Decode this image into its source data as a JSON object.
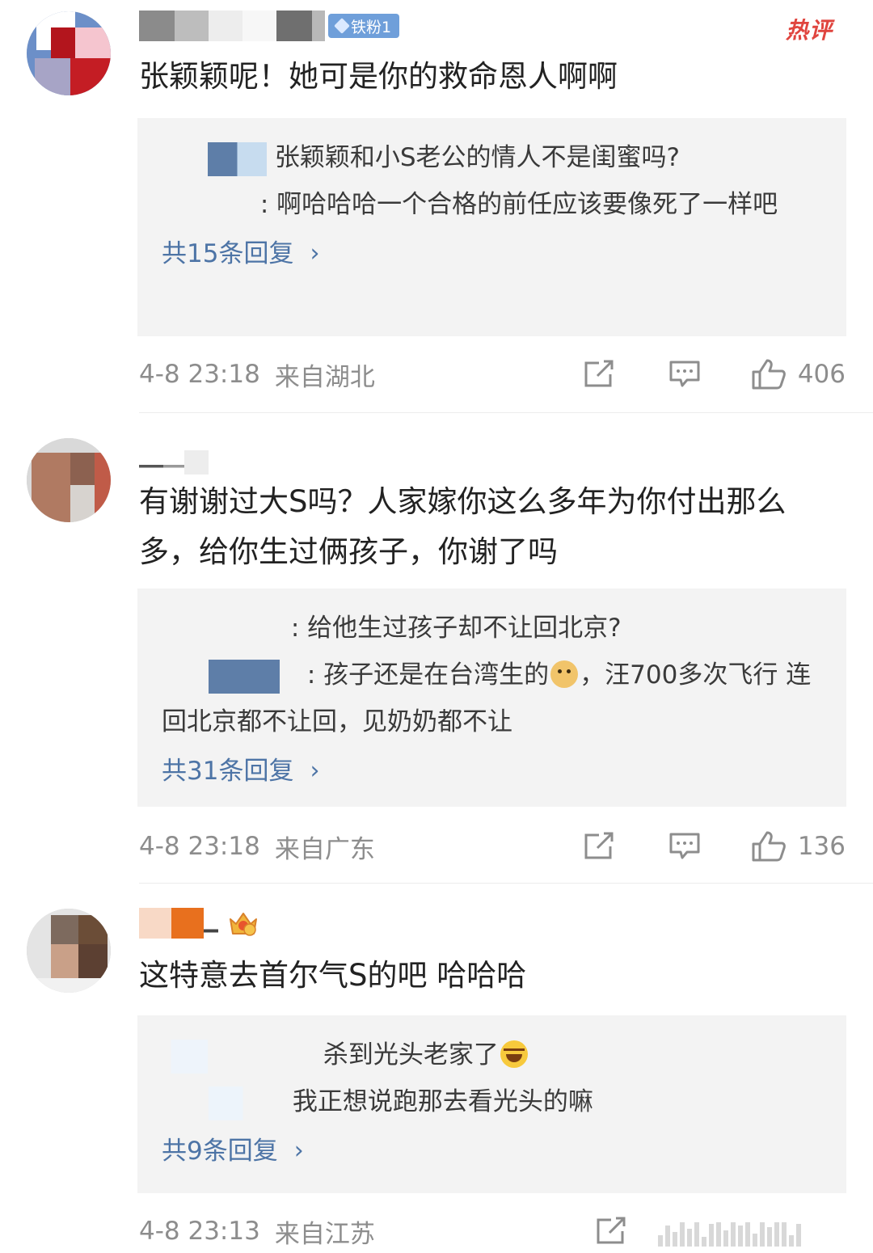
{
  "hot_label": "热评",
  "fan_badge": "铁粉1",
  "comments": [
    {
      "text": "张颖颖呢！她可是你的救命恩人啊啊",
      "replies": [
        {
          "text": "张颖颖和小S老公的情人不是闺蜜吗?"
        },
        {
          "text": ": 啊哈哈哈一个合格的前任应该要像死了一样吧"
        }
      ],
      "more_replies": "共15条回复",
      "time": "4-8 23:18",
      "location": "来自湖北",
      "likes": "406"
    },
    {
      "text": "有谢谢过大S吗？人家嫁你这么多年为你付出那么多，给你生过俩孩子，你谢了吗",
      "replies": [
        {
          "text": ": 给他生过孩子却不让回北京?"
        },
        {
          "text_before": ": 孩子还是在台湾生的",
          "text_after": "，汪700多次飞行 连回北京都不让回，见奶奶都不让",
          "emoji": "doge-icon"
        }
      ],
      "more_replies": "共31条回复",
      "time": "4-8 23:18",
      "location": "来自广东",
      "likes": "136"
    },
    {
      "text": "这特意去首尔气S的吧 哈哈哈",
      "replies": [
        {
          "text": "杀到光头老家了",
          "emoji": "laugh-cry-icon"
        },
        {
          "text": "我正想说跑那去看光头的嘛"
        }
      ],
      "more_replies": "共9条回复",
      "time": "4-8 23:13",
      "location": "来自江苏"
    }
  ]
}
